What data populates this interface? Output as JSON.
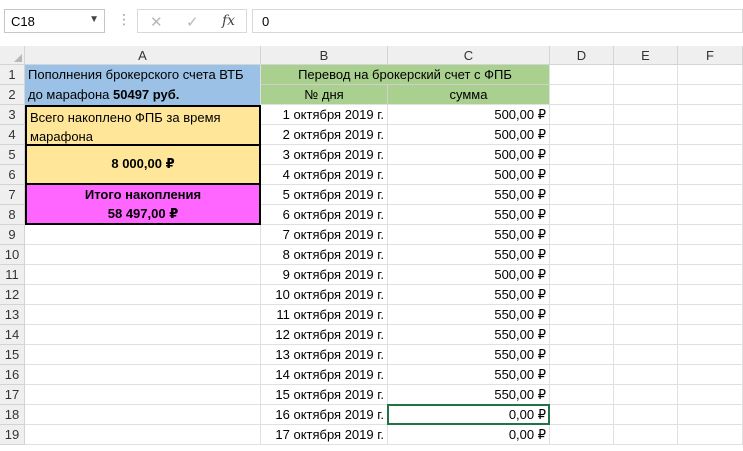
{
  "name_box": "C18",
  "formula_value": "0",
  "formula_buttons": {
    "cancel": "✕",
    "enter": "✓",
    "fx": "fx"
  },
  "columns": [
    "A",
    "B",
    "C",
    "D",
    "E",
    "F"
  ],
  "rows": [
    "1",
    "2",
    "3",
    "4",
    "5",
    "6",
    "7",
    "8",
    "9",
    "10",
    "11",
    "12",
    "13",
    "14",
    "15",
    "16",
    "17",
    "18",
    "19"
  ],
  "blocks": {
    "a1_line1": "Пополнения брокерского счета ВТБ",
    "a1_line2": "до марафона ",
    "a1_line2_bold": "50497 руб.",
    "a3_line1": "Всего накоплено ФПБ за время",
    "a3_line2": "марафона",
    "a5": "8 000,00 ₽",
    "a7_line1": "Итого накопления",
    "a7_line2": "58 497,00 ₽",
    "b1": "Перевод на брокерский счет с ФПБ",
    "b2": "№ дня",
    "c2": "сумма"
  },
  "table": [
    {
      "date": "1 октября 2019 г.",
      "amount": "500,00 ₽"
    },
    {
      "date": "2 октября 2019 г.",
      "amount": "500,00 ₽"
    },
    {
      "date": "3 октября 2019 г.",
      "amount": "500,00 ₽"
    },
    {
      "date": "4 октября 2019 г.",
      "amount": "500,00 ₽"
    },
    {
      "date": "5 октября 2019 г.",
      "amount": "550,00 ₽"
    },
    {
      "date": "6 октября 2019 г.",
      "amount": "550,00 ₽"
    },
    {
      "date": "7 октября 2019 г.",
      "amount": "550,00 ₽"
    },
    {
      "date": "8 октября 2019 г.",
      "amount": "550,00 ₽"
    },
    {
      "date": "9 октября 2019 г.",
      "amount": "500,00 ₽"
    },
    {
      "date": "10 октября 2019 г.",
      "amount": "550,00 ₽"
    },
    {
      "date": "11 октября 2019 г.",
      "amount": "550,00 ₽"
    },
    {
      "date": "12 октября 2019 г.",
      "amount": "550,00 ₽"
    },
    {
      "date": "13 октября 2019 г.",
      "amount": "550,00 ₽"
    },
    {
      "date": "14 октября 2019 г.",
      "amount": "550,00 ₽"
    },
    {
      "date": "15 октября 2019 г.",
      "amount": "550,00 ₽"
    },
    {
      "date": "16 октября 2019 г.",
      "amount": "0,00 ₽"
    },
    {
      "date": "17 октября 2019 г.",
      "amount": "0,00 ₽"
    }
  ]
}
